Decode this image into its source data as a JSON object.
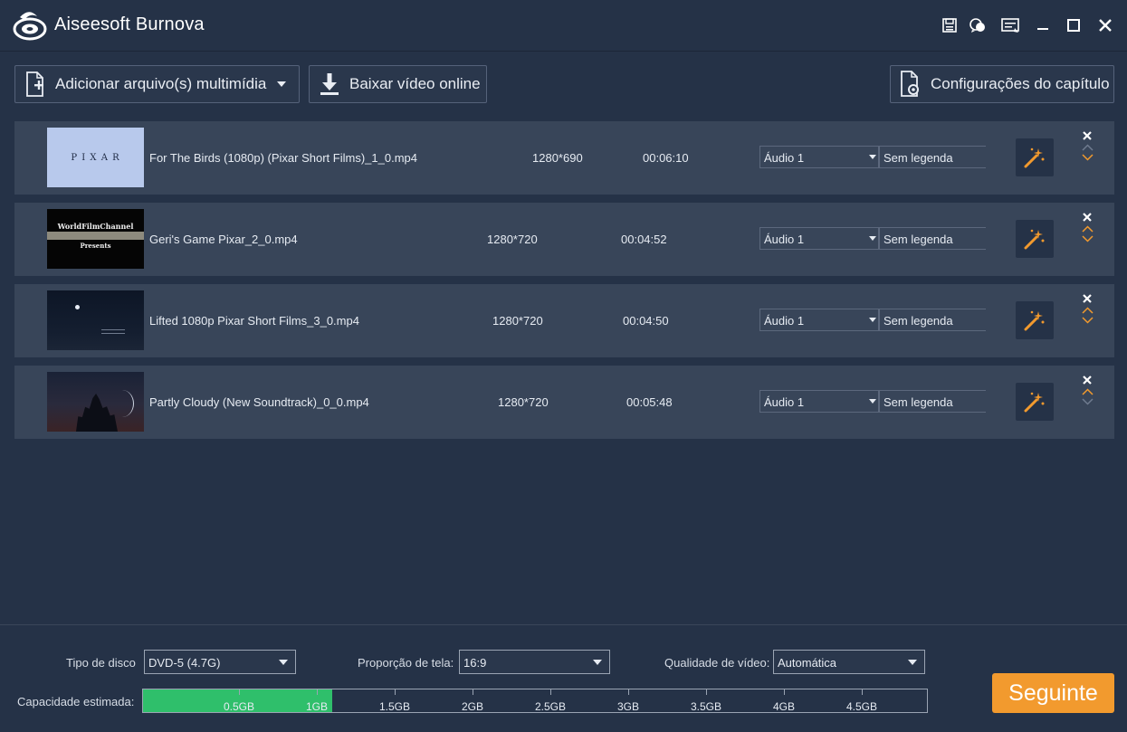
{
  "app": {
    "title": "Aiseesoft Burnova"
  },
  "toolbar": {
    "add_media_label": "Adicionar arquivo(s) multimídia",
    "download_label": "Baixar vídeo online",
    "chapter_label": "Configurações do capítulo"
  },
  "files": [
    {
      "name": "For The Birds (1080p) (Pixar Short Films)_1_0.mp4",
      "resolution": "1280*690",
      "duration": "00:06:10",
      "audio": "Áudio 1",
      "subtitle": "Sem legenda",
      "thumb_text": "P I X A R"
    },
    {
      "name": "Geri's Game Pixar_2_0.mp4",
      "resolution": "1280*720",
      "duration": "00:04:52",
      "audio": "Áudio 1",
      "subtitle": "Sem legenda",
      "thumb_text_1": "WorldFilmChannel",
      "thumb_text_2": "Presents"
    },
    {
      "name": "Lifted 1080p Pixar Short Films_3_0.mp4",
      "resolution": "1280*720",
      "duration": "00:04:50",
      "audio": "Áudio 1",
      "subtitle": "Sem legenda"
    },
    {
      "name": "Partly Cloudy (New Soundtrack)_0_0.mp4",
      "resolution": "1280*720",
      "duration": "00:05:48",
      "audio": "Áudio 1",
      "subtitle": "Sem legenda"
    }
  ],
  "settings": {
    "disc_type_label": "Tipo de disco",
    "disc_type_value": "DVD-5 (4.7G)",
    "aspect_label": "Proporção de tela:",
    "aspect_value": "16:9",
    "quality_label": "Qualidade de vídeo:",
    "quality_value": "Automática",
    "capacity_label": "Capacidade estimada:",
    "capacity_used_gb": 1.1,
    "capacity_ticks": [
      "0.5GB",
      "1GB",
      "1.5GB",
      "2GB",
      "2.5GB",
      "3GB",
      "3.5GB",
      "4GB",
      "4.5GB"
    ]
  },
  "next_label": "Seguinte",
  "colors": {
    "accent": "#f29a2e",
    "capacity_fill": "#2fbf6b",
    "background": "#253247",
    "row": "#384559"
  }
}
